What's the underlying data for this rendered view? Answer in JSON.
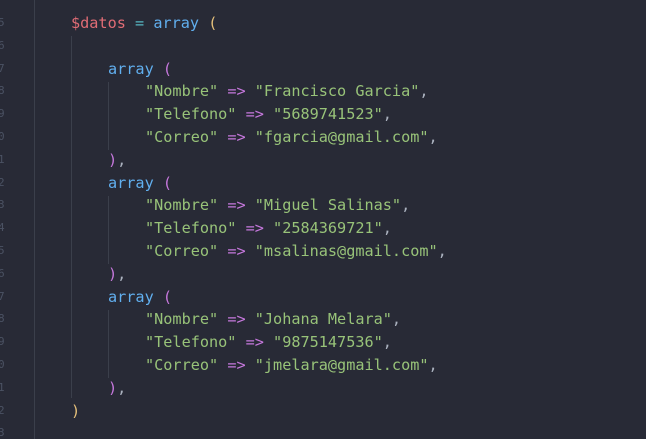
{
  "code": {
    "var_name": "$datos",
    "assign": "=",
    "array_kw": "array",
    "open_paren": "(",
    "close_paren": ")",
    "arrow": "=>",
    "comma": ",",
    "close_entry": "),",
    "records": [
      {
        "rows": [
          {
            "key": "\"Nombre\"",
            "value": "\"Francisco Garcia\""
          },
          {
            "key": "\"Telefono\"",
            "value": "\"5689741523\""
          },
          {
            "key": "\"Correo\"",
            "value": "\"fgarcia@gmail.com\""
          }
        ]
      },
      {
        "rows": [
          {
            "key": "\"Nombre\"",
            "value": "\"Miguel Salinas\""
          },
          {
            "key": "\"Telefono\"",
            "value": "\"2584369721\""
          },
          {
            "key": "\"Correo\"",
            "value": "\"msalinas@gmail.com\""
          }
        ]
      },
      {
        "rows": [
          {
            "key": "\"Nombre\"",
            "value": "\"Johana Melara\""
          },
          {
            "key": "\"Telefono\"",
            "value": "\"9875147536\""
          },
          {
            "key": "\"Correo\"",
            "value": "\"jmelara@gmail.com\""
          }
        ]
      }
    ]
  },
  "gutter": {
    "numbers": [
      "5",
      "6",
      "7",
      "8",
      "9",
      "0",
      "1",
      "2",
      "3",
      "4",
      "5",
      "6",
      "7",
      "8",
      "9",
      "0",
      "1",
      "2",
      "3"
    ]
  },
  "colors": {
    "background": "#282a36",
    "variable": "#e06c75",
    "keyword": "#61afef",
    "string": "#98c379",
    "operator": "#c678dd",
    "paren_outer": "#e5c07b",
    "paren_inner": "#c678dd"
  }
}
